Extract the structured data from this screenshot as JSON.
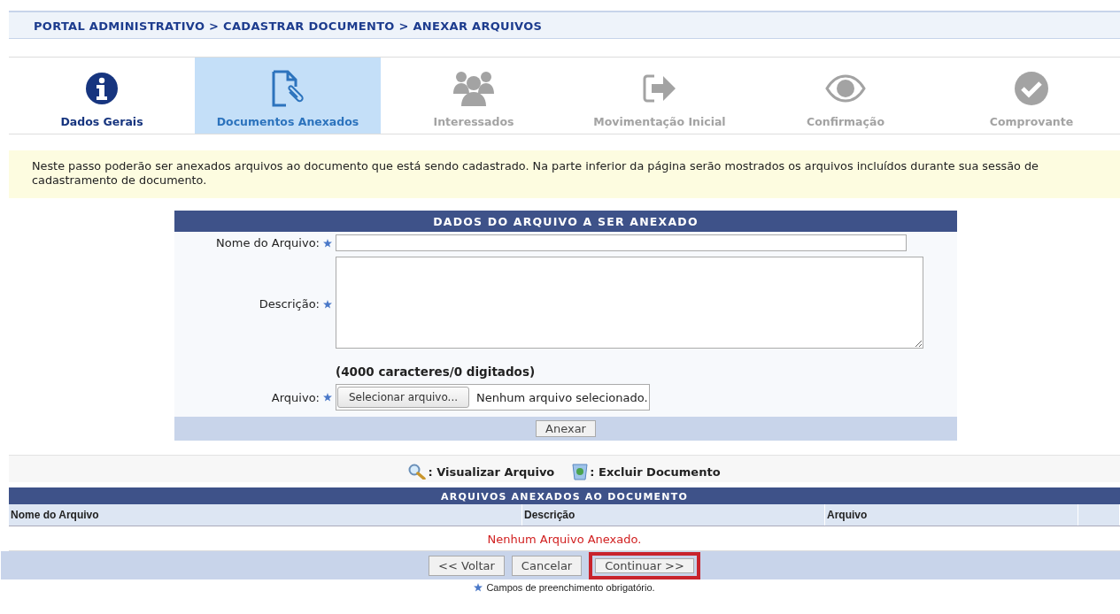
{
  "breadcrumb": "PORTAL ADMINISTRATIVO > CADASTRAR DOCUMENTO > ANEXAR ARQUIVOS",
  "steps": [
    {
      "label": "Dados Gerais",
      "kind": "info",
      "selected": false,
      "disabled": false
    },
    {
      "label": "Documentos Anexados",
      "kind": "document",
      "selected": true,
      "disabled": false
    },
    {
      "label": "Interessados",
      "kind": "people",
      "selected": false,
      "disabled": true
    },
    {
      "label": "Movimentação Inicial",
      "kind": "exit",
      "selected": false,
      "disabled": true
    },
    {
      "label": "Confirmação",
      "kind": "eye",
      "selected": false,
      "disabled": true
    },
    {
      "label": "Comprovante",
      "kind": "check",
      "selected": false,
      "disabled": true
    }
  ],
  "info_message": "Neste passo poderão ser anexados arquivos ao documento que está sendo cadastrado. Na parte inferior da página serão mostrados os arquivos incluídos durante sua sessão de cadastramento de documento.",
  "form": {
    "title": "DADOS DO ARQUIVO A SER ANEXADO",
    "fields": [
      {
        "kind": "text",
        "label": "Nome do Arquivo:",
        "required": true
      },
      {
        "kind": "textarea",
        "label": "Descrição:",
        "required": true,
        "counter": "(4000 caracteres/0 digitados)"
      },
      {
        "kind": "file",
        "label": "Arquivo:",
        "required": true,
        "button": "Selecionar arquivo...",
        "status": "Nenhum arquivo selecionado."
      }
    ],
    "submit": "Anexar"
  },
  "legend": [
    {
      "kind": "search",
      "text": ": Visualizar Arquivo"
    },
    {
      "kind": "trash",
      "text": ": Excluir Documento"
    }
  ],
  "files_table": {
    "title": "ARQUIVOS ANEXADOS AO DOCUMENTO",
    "columns": [
      "Nome do Arquivo",
      "Descrição",
      "Arquivo"
    ],
    "empty_message": "Nenhum Arquivo Anexado."
  },
  "actions": [
    {
      "label": "<< Voltar",
      "highlighted": false
    },
    {
      "label": "Cancelar",
      "highlighted": false
    },
    {
      "label": "Continuar >>",
      "highlighted": true
    }
  ],
  "footnote": "Campos de preenchimento obrigatório."
}
